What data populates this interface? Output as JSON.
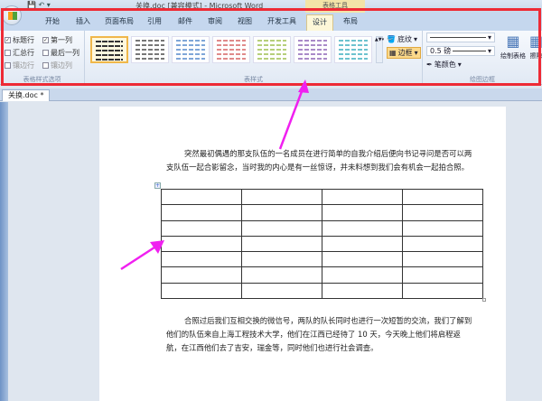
{
  "window": {
    "title": "关换.doc [兼容模式] - Microsoft Word",
    "context_tab": "表格工具"
  },
  "tabs": [
    "开始",
    "插入",
    "页面布局",
    "引用",
    "邮件",
    "审阅",
    "视图",
    "开发工具",
    "设计",
    "布局"
  ],
  "active_tab": "设计",
  "style_options": {
    "label": "表格样式选项",
    "items": [
      {
        "label": "标题行",
        "checked": true,
        "enabled": true
      },
      {
        "label": "第一列",
        "checked": true,
        "enabled": true
      },
      {
        "label": "汇总行",
        "checked": false,
        "enabled": true
      },
      {
        "label": "最后一列",
        "checked": false,
        "enabled": true
      },
      {
        "label": "镶边行",
        "checked": false,
        "enabled": false
      },
      {
        "label": "镶边列",
        "checked": false,
        "enabled": false
      }
    ]
  },
  "table_styles": {
    "label": "表样式",
    "colors": [
      "#555555",
      "#777777",
      "#7fa6d8",
      "#e08a8a",
      "#b6cf7a",
      "#a98ac8",
      "#6cc2cf"
    ],
    "shading": "底纹",
    "borders": "边框"
  },
  "draw_borders": {
    "label": "绘图边框",
    "weight": "0.5 磅",
    "pen_color": "笔颜色",
    "draw_table": "绘制表格",
    "eraser": "擦除"
  },
  "document": {
    "tab": "关换.doc *",
    "para1": "突然最初偶遇的那支队伍的一名成员在进行简单的自我介绍后便向书记寻问是否可以两支队伍一起合影留念，当时我的内心是有一丝惊讶，并未料想到我们会有机会一起拍合照。",
    "para2": "合照过后我们互相交换的微信号，两队的队长同时也进行一次短暂的交流，我们了解到他们的队伍来自上海工程技术大学，他们在江西已经待了 10 天，今天晚上他们将启程返航，在江西他们去了吉安，瑞金等，同时他们也进行社会调查。",
    "table": {
      "rows": 7,
      "cols": 4
    }
  },
  "annotation_color": "#ee2a35",
  "arrow_color": "#f020f0"
}
